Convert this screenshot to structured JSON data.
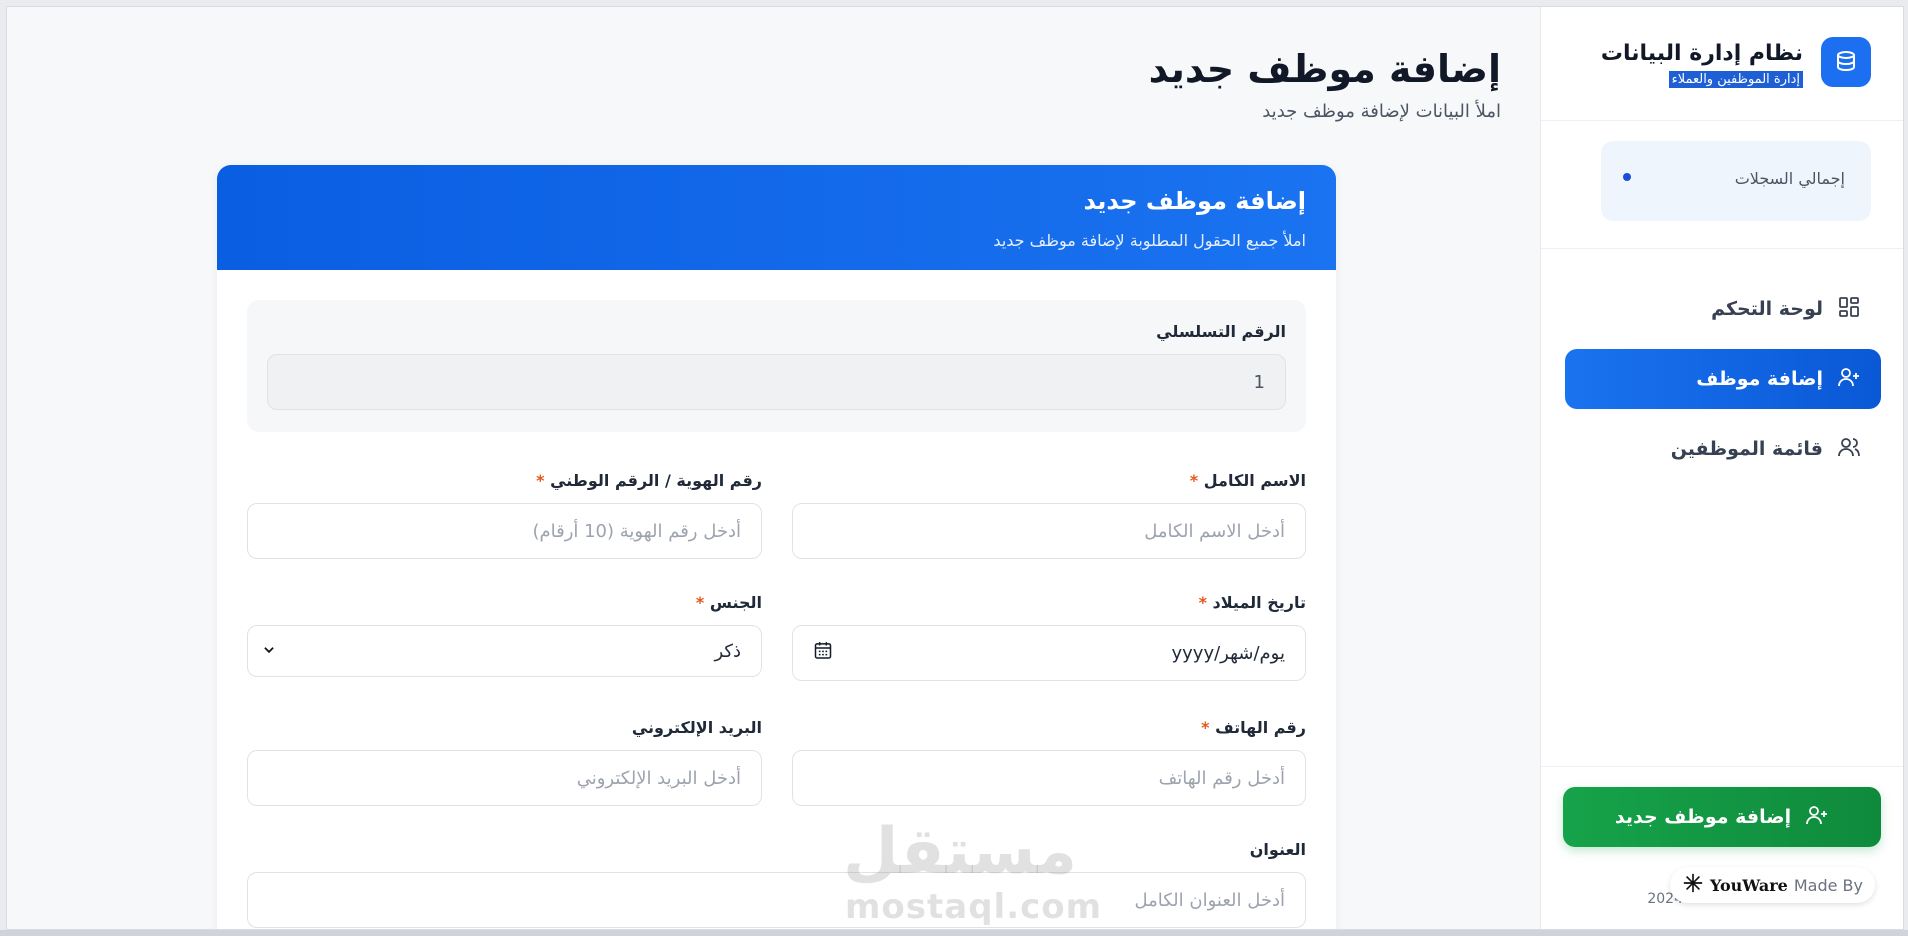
{
  "page": {
    "title": "إضافة موظف جديد",
    "subtitle": "املأ البيانات لإضافة موظف جديد"
  },
  "sidebar": {
    "brand_title": "نظام إدارة البيانات",
    "brand_subtitle": "إدارة الموظفين والعملاء",
    "brand_icon": "database-icon",
    "stats_label": "إجمالي السجلات",
    "nav": [
      {
        "label": "لوحة التحكم",
        "icon": "dashboard-grid-icon",
        "active": false
      },
      {
        "label": "إضافة موظف",
        "icon": "user-plus-icon",
        "active": true
      },
      {
        "label": "قائمة الموظفين",
        "icon": "users-icon",
        "active": false
      }
    ],
    "cta_label": "إضافة موظف جديد",
    "footer_year": "2024",
    "made_by_prefix": "Made By",
    "made_by_brand": "YouWare"
  },
  "form": {
    "header_title": "إضافة موظف جديد",
    "header_subtitle": "املأ جميع الحقول المطلوبة لإضافة موظف جديد",
    "serial_label": "الرقم التسلسلي",
    "serial_value": "1",
    "full_name_label": "الاسم الكامل",
    "full_name_placeholder": "أدخل الاسم الكامل",
    "national_id_label": "رقم الهوية / الرقم الوطني",
    "national_id_placeholder": "أدخل رقم الهوية (10 أرقام)",
    "birth_date_label": "تاريخ الميلاد",
    "birth_date_value": "يوم/شهر/yyyy",
    "gender_label": "الجنس",
    "gender_value": "ذكر",
    "phone_label": "رقم الهاتف",
    "phone_placeholder": "أدخل رقم الهاتف",
    "email_label": "البريد الإلكتروني",
    "email_placeholder": "أدخل البريد الإلكتروني",
    "address_label": "العنوان",
    "address_placeholder": "أدخل العنوان الكامل",
    "required_mark": "*"
  },
  "watermark": {
    "arabic": "مستقل",
    "latin": "mostaql.com"
  },
  "colors": {
    "primary": "#1a73f0",
    "success": "#16a34a",
    "required": "#e4571c"
  }
}
